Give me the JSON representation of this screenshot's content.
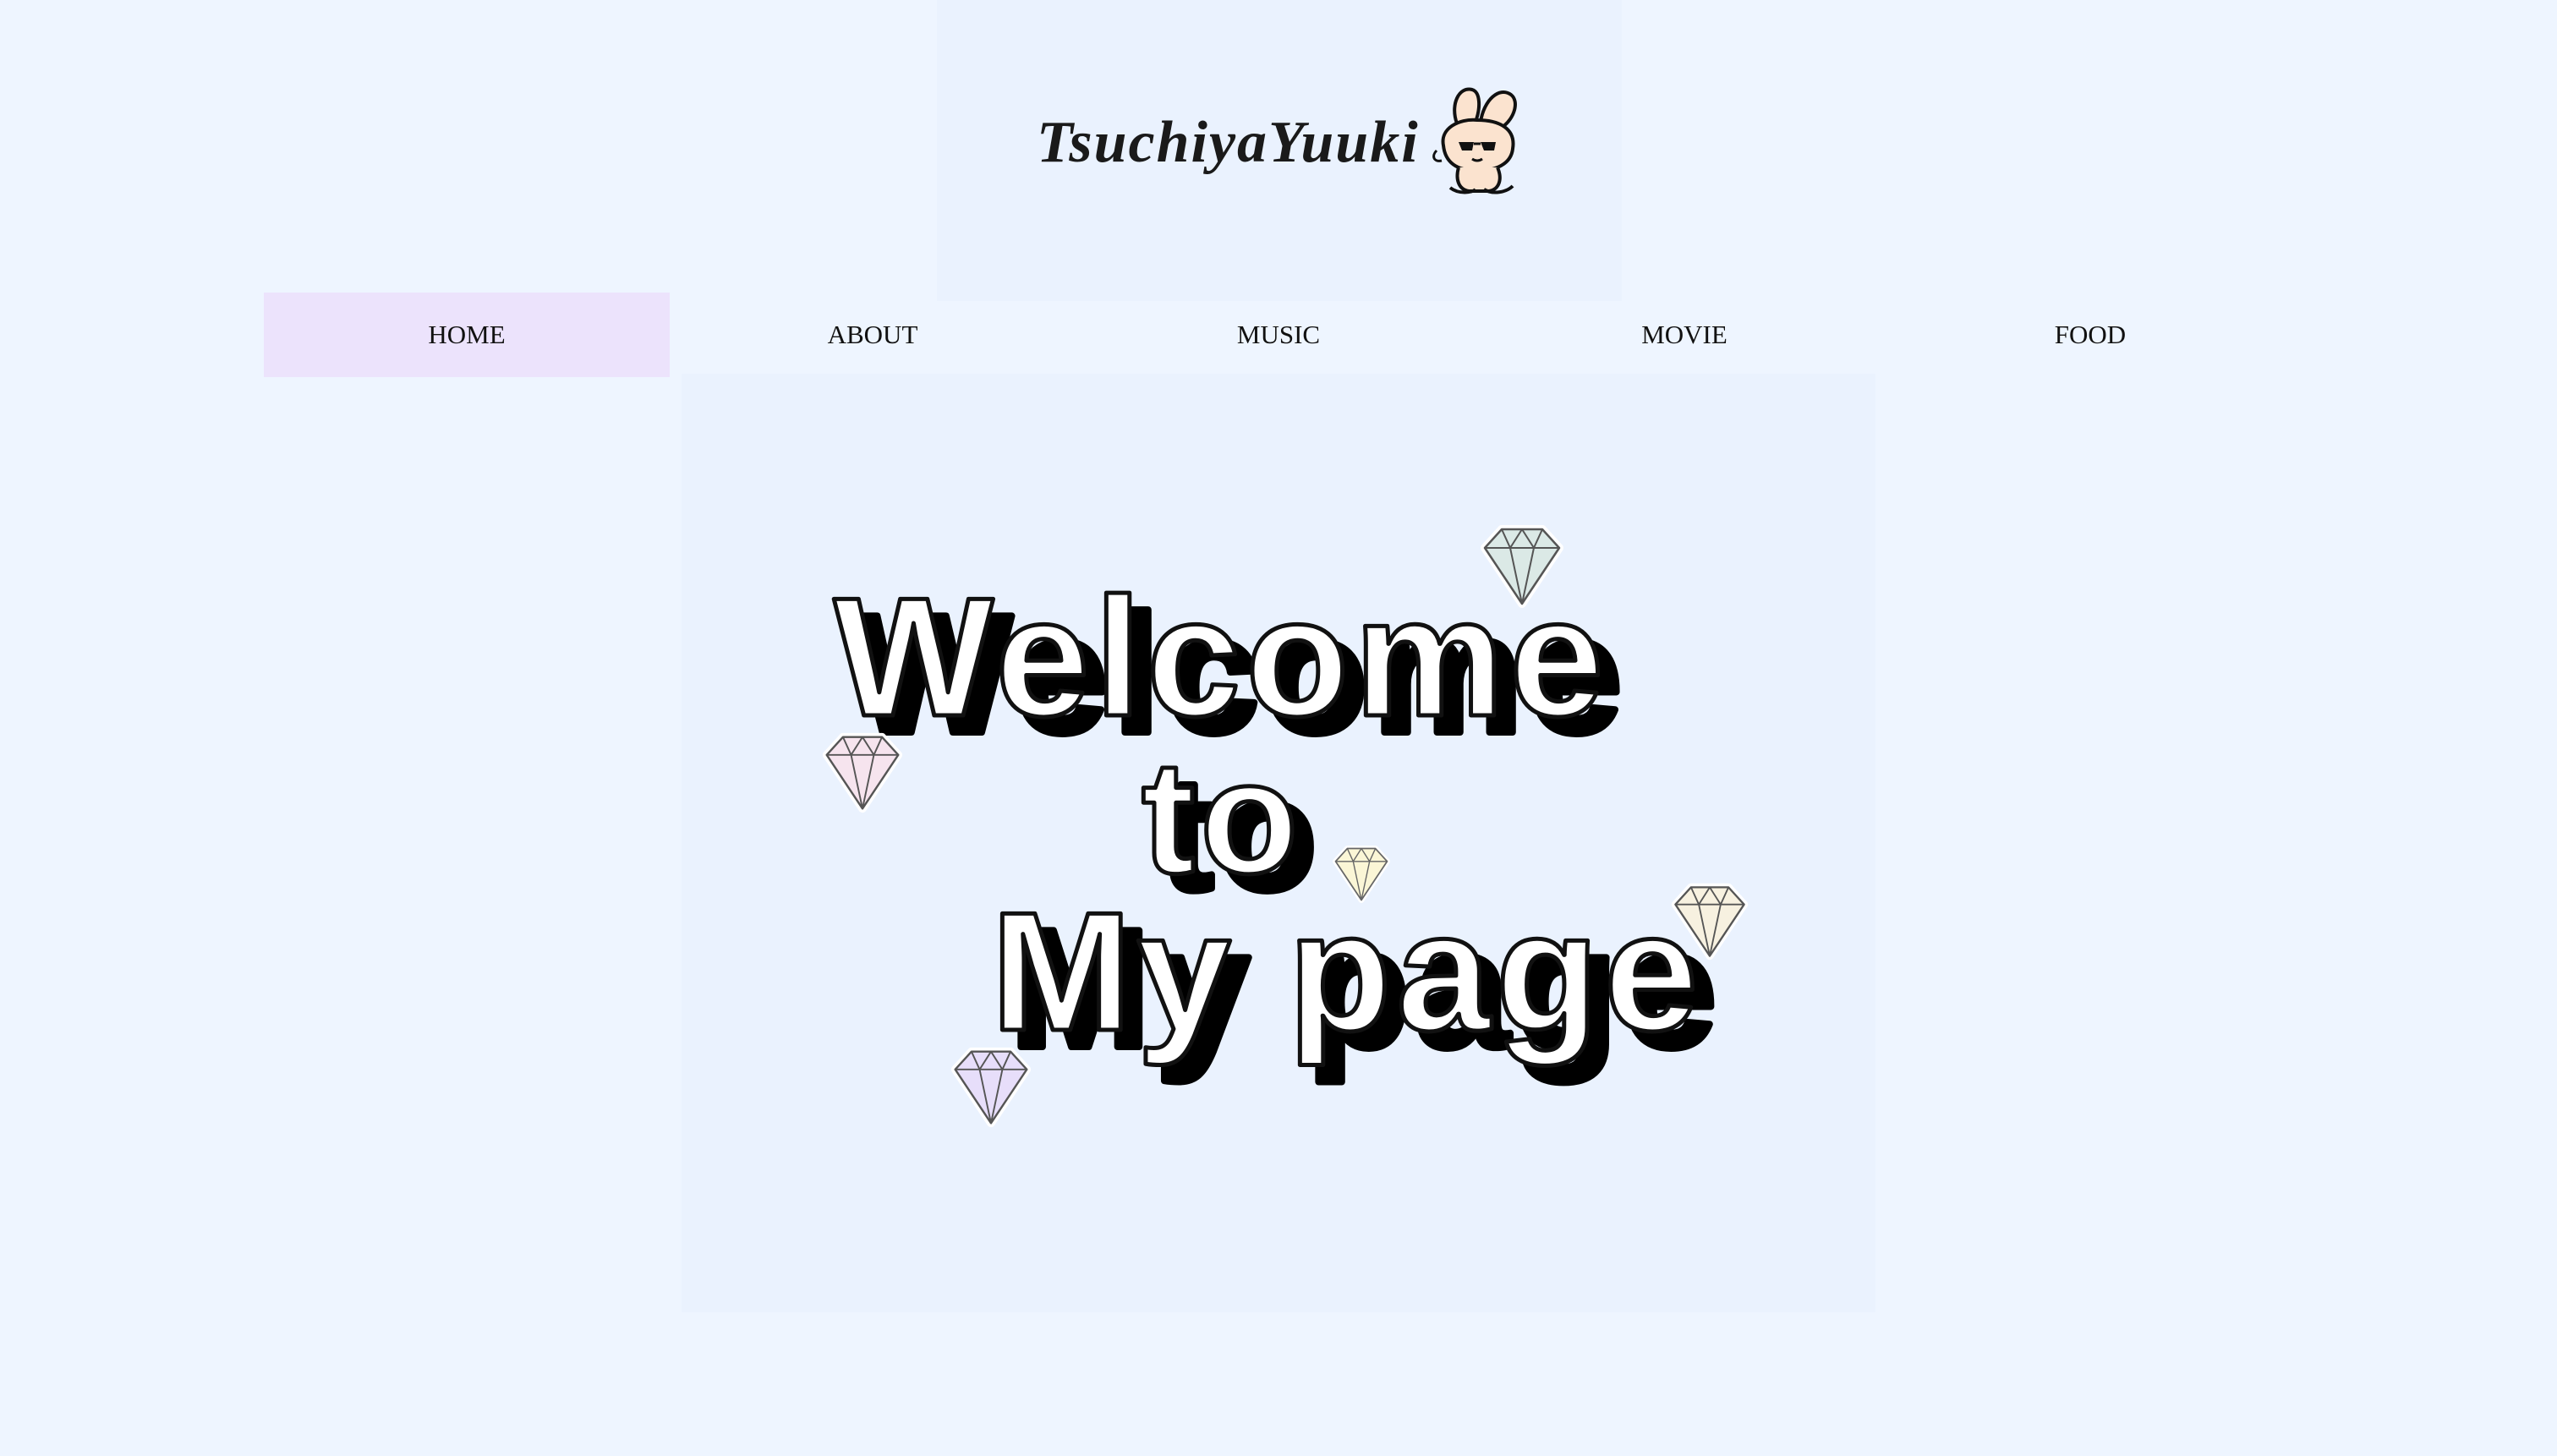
{
  "header": {
    "logo_text": "TsuchiyaYuuki",
    "mascot_icon": "bunny-mascot-icon"
  },
  "nav": {
    "items": [
      {
        "label": "HOME",
        "active": true
      },
      {
        "label": "ABOUT",
        "active": false
      },
      {
        "label": "MUSIC",
        "active": false
      },
      {
        "label": "MOVIE",
        "active": false
      },
      {
        "label": "FOOD",
        "active": false
      }
    ],
    "active_color": "#ece3fc"
  },
  "hero": {
    "line1": "Welcome",
    "line2": "to",
    "line3": "My page"
  },
  "decorations": {
    "gem_icons": [
      "diamond-icon-green",
      "diamond-icon-pink",
      "diamond-icon-yellow",
      "diamond-icon-cream",
      "diamond-icon-purple"
    ],
    "gem_colors": [
      "#dbe9e6",
      "#f6e4ee",
      "#fbf6d6",
      "#f7f1e0",
      "#e7defa"
    ]
  },
  "colors": {
    "background": "#eef5ff",
    "panel": "#eaf2fe"
  }
}
